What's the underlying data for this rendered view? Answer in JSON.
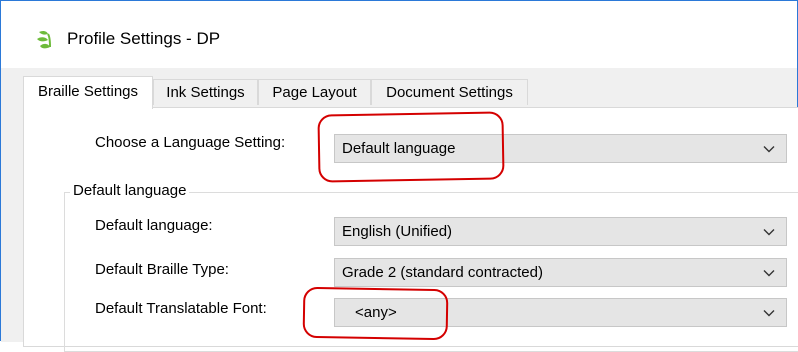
{
  "window": {
    "title": "Profile Settings - DP",
    "icon": "profile-leaf-icon"
  },
  "tabs": [
    {
      "label": "Braille Settings",
      "active": true
    },
    {
      "label": "Ink Settings",
      "active": false
    },
    {
      "label": "Page Layout",
      "active": false
    },
    {
      "label": "Document Settings",
      "active": false
    }
  ],
  "language_setting": {
    "label": "Choose a Language Setting:",
    "value": "Default language"
  },
  "default_group": {
    "legend": "Default language",
    "language": {
      "label": "Default language:",
      "value": "English (Unified)"
    },
    "braille_type": {
      "label": "Default Braille Type:",
      "value": "Grade 2 (standard contracted)"
    },
    "translatable_font": {
      "label": "Default Translatable Font:",
      "value": "<any>"
    }
  },
  "colors": {
    "window_border": "#2b79d8",
    "annotation": "#d40000",
    "icon_green": "#6dbb3a"
  }
}
